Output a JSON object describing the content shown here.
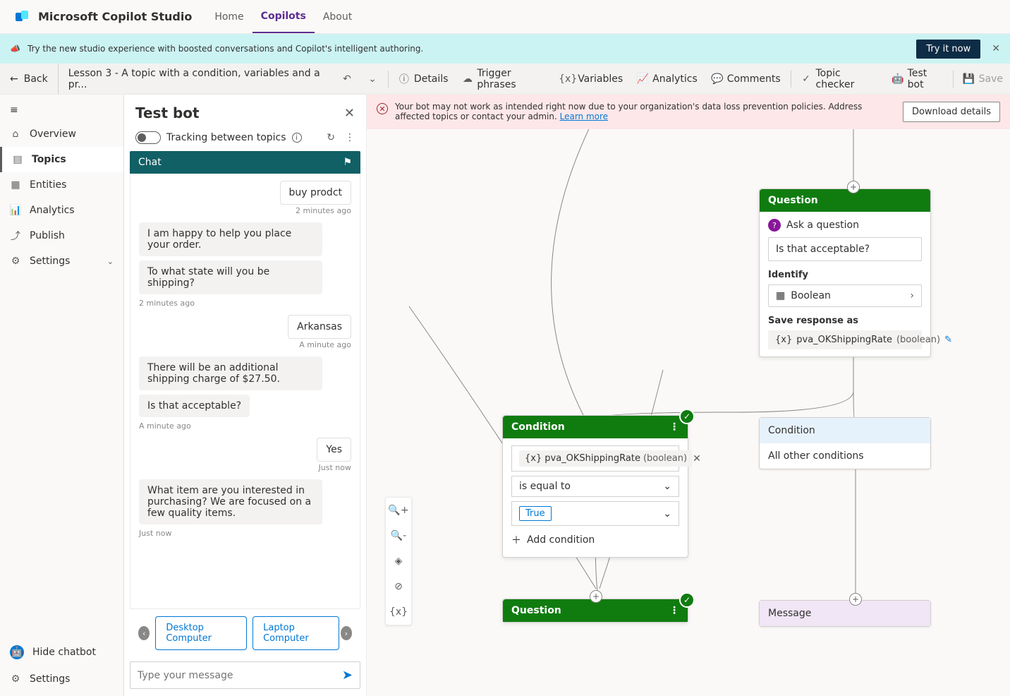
{
  "app": {
    "title": "Microsoft Copilot Studio"
  },
  "nav": {
    "home": "Home",
    "copilots": "Copilots",
    "about": "About"
  },
  "banner": {
    "text": "Try the new studio experience with boosted conversations and Copilot's intelligent authoring.",
    "cta": "Try it now"
  },
  "subbar": {
    "back": "Back",
    "breadcrumb": "Lesson 3 - A topic with a condition, variables and a pr...",
    "details": "Details",
    "trigger": "Trigger phrases",
    "variables": "Variables",
    "analytics": "Analytics",
    "comments": "Comments",
    "topic_checker": "Topic checker",
    "test_bot": "Test bot",
    "save": "Save"
  },
  "rail": {
    "overview": "Overview",
    "topics": "Topics",
    "entities": "Entities",
    "analytics": "Analytics",
    "publish": "Publish",
    "settings": "Settings",
    "hide_chatbot": "Hide chatbot",
    "settings2": "Settings"
  },
  "testpanel": {
    "title": "Test bot",
    "tracking": "Tracking between topics",
    "chat_header": "Chat",
    "msgs": {
      "u1": "buy prodct",
      "t1": "2 minutes ago",
      "b1": "I am happy to help you place your order.",
      "b2": "To what state will you be shipping?",
      "t2": "2 minutes ago",
      "u2": "Arkansas",
      "t3": "A minute ago",
      "b3": "There will be an additional shipping charge of $27.50.",
      "b4": "Is that acceptable?",
      "t4": "A minute ago",
      "u3": "Yes",
      "t5": "Just now",
      "b5": "What item are you interested in purchasing? We are focused on a few quality items.",
      "t6": "Just now"
    },
    "chips": {
      "c1": "Desktop Computer",
      "c2": "Laptop Computer"
    },
    "placeholder": "Type your message"
  },
  "warning": {
    "text": "Your bot may not work as intended right now due to your organization's data loss prevention policies. Address affected topics or contact your admin. ",
    "link": "Learn more",
    "download": "Download details"
  },
  "nodes": {
    "question": {
      "head": "Question",
      "ask": "Ask a question",
      "text": "Is that acceptable?",
      "identify": "Identify",
      "identify_val": "Boolean",
      "save_as": "Save response as",
      "var_name": "pva_OKShippingRate",
      "var_type": "(boolean)"
    },
    "condition": {
      "head": "Condition",
      "var_name": "pva_OKShippingRate",
      "var_type": "(boolean)",
      "op": "is equal to",
      "val": "True",
      "add": "Add condition"
    },
    "cond2": {
      "head": "Condition",
      "other": "All other conditions"
    },
    "question2": "Question",
    "message": "Message"
  }
}
